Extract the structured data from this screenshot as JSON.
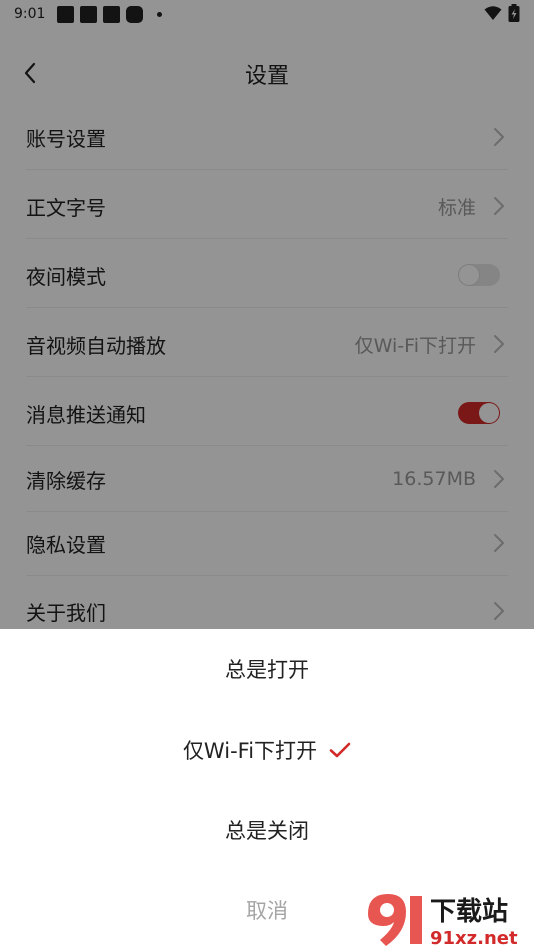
{
  "status_bar": {
    "time": "9:01"
  },
  "header": {
    "title": "设置"
  },
  "settings": [
    {
      "label": "账号设置",
      "value": "",
      "control": "chevron"
    },
    {
      "label": "正文字号",
      "value": "标准",
      "control": "chevron"
    },
    {
      "label": "夜间模式",
      "value": "",
      "control": "toggle",
      "toggle_on": false
    },
    {
      "label": "音视频自动播放",
      "value": "仅Wi-Fi下打开",
      "control": "chevron"
    },
    {
      "label": "消息推送通知",
      "value": "",
      "control": "toggle",
      "toggle_on": true
    },
    {
      "label": "清除缓存",
      "value": "16.57MB",
      "control": "chevron"
    },
    {
      "label": "隐私设置",
      "value": "",
      "control": "chevron"
    },
    {
      "label": "关于我们",
      "value": "",
      "control": "chevron"
    }
  ],
  "sheet": {
    "options": [
      {
        "label": "总是打开",
        "selected": false
      },
      {
        "label": "仅Wi-Fi下打开",
        "selected": true
      },
      {
        "label": "总是关闭",
        "selected": false
      }
    ],
    "cancel_label": "取消"
  },
  "watermark": {
    "brand_text": "下载站",
    "url_text": "91xz.net"
  },
  "colors": {
    "accent": "#d22a2a",
    "text": "#222222",
    "secondary": "#9a9a9a"
  }
}
